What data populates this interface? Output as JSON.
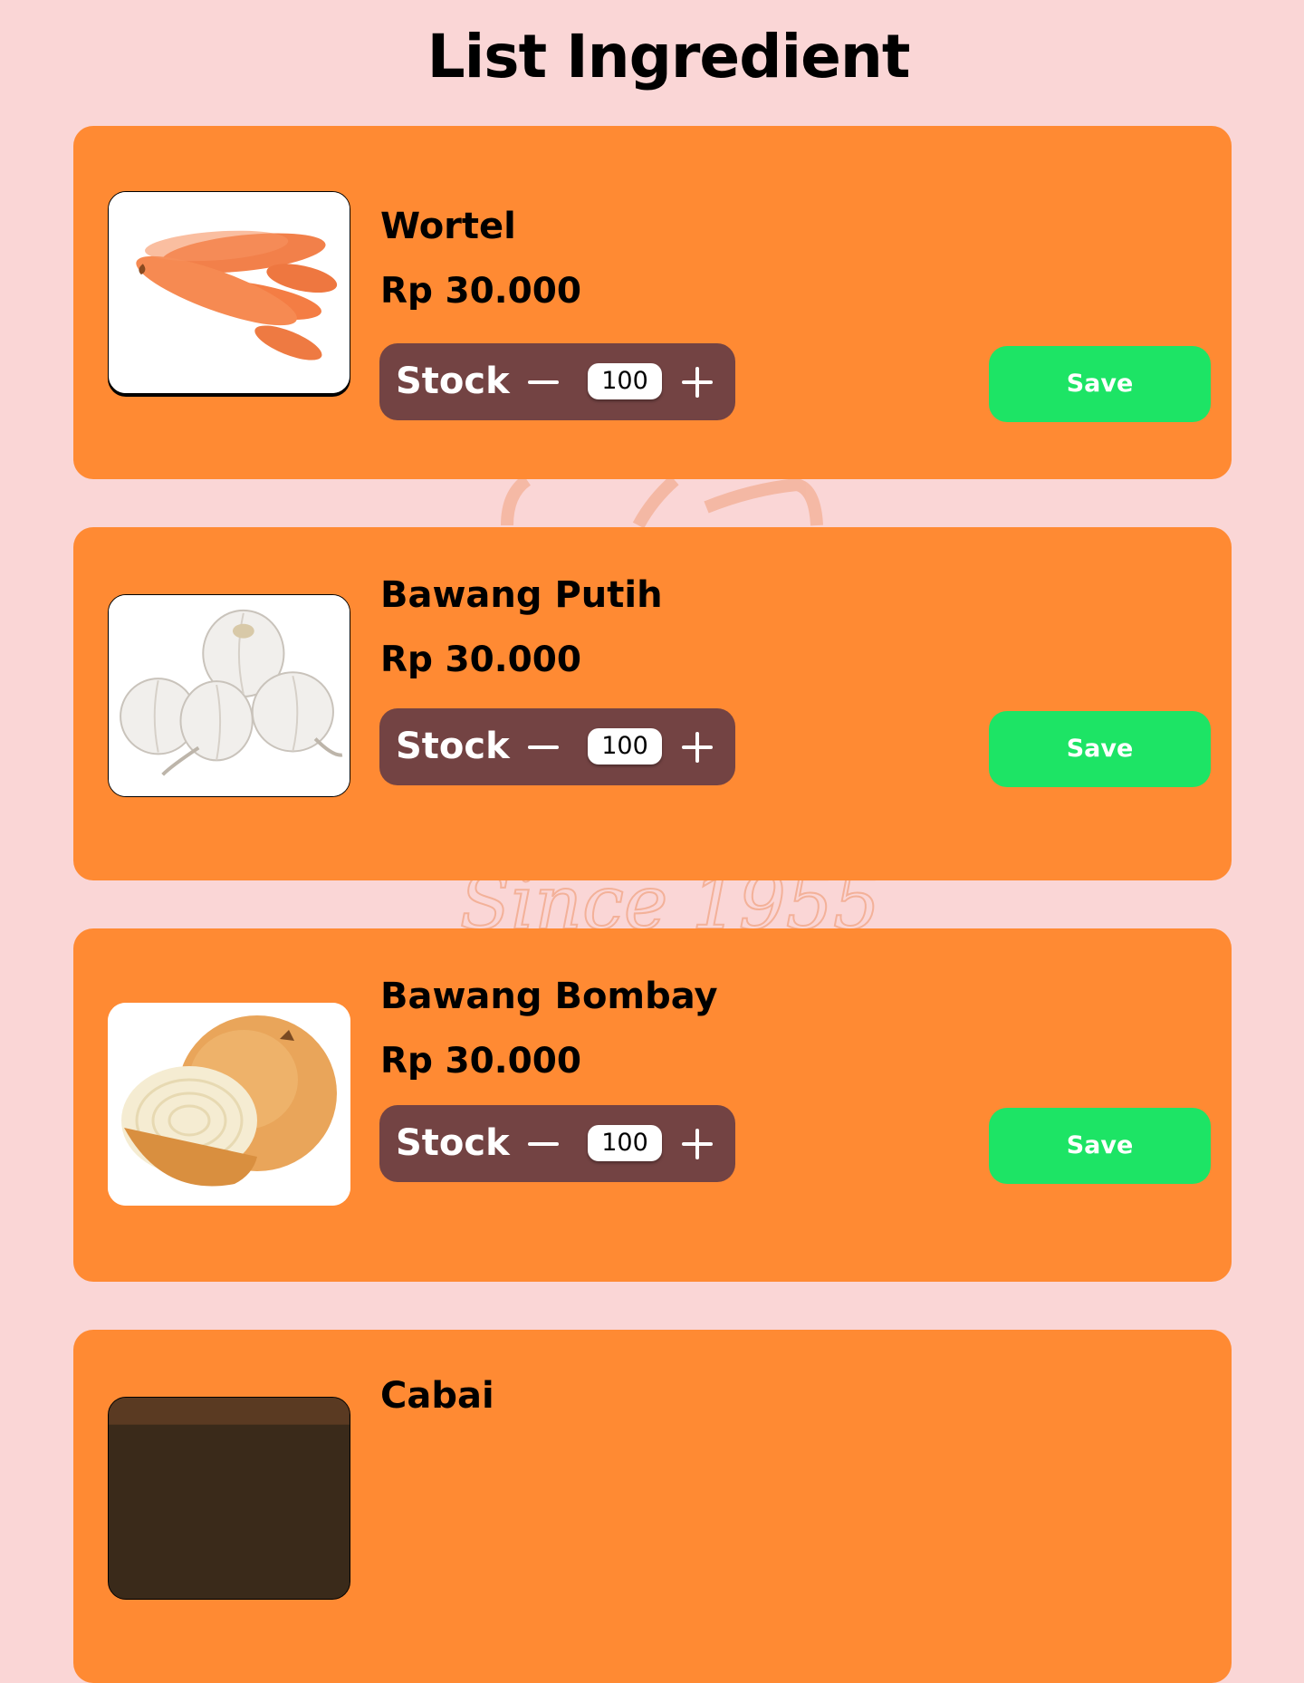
{
  "page": {
    "title": "List Ingredient",
    "watermark_text": "Since 1955"
  },
  "theme": {
    "background": "#fad6d6",
    "card": "#ff8a33",
    "stock_bar": "#734343",
    "save_button": "#1de465"
  },
  "ingredients": [
    {
      "name": "Wortel",
      "price": "Rp 30.000",
      "stock_label": "Stock",
      "quantity": "100",
      "save_label": "Save",
      "image_icon": "carrot-image"
    },
    {
      "name": "Bawang Putih",
      "price": "Rp 30.000",
      "stock_label": "Stock",
      "quantity": "100",
      "save_label": "Save",
      "image_icon": "garlic-image"
    },
    {
      "name": "Bawang Bombay",
      "price": "Rp 30.000",
      "stock_label": "Stock",
      "quantity": "100",
      "save_label": "Save",
      "image_icon": "onion-image"
    },
    {
      "name": "Cabai",
      "image_icon": "chili-image"
    }
  ]
}
